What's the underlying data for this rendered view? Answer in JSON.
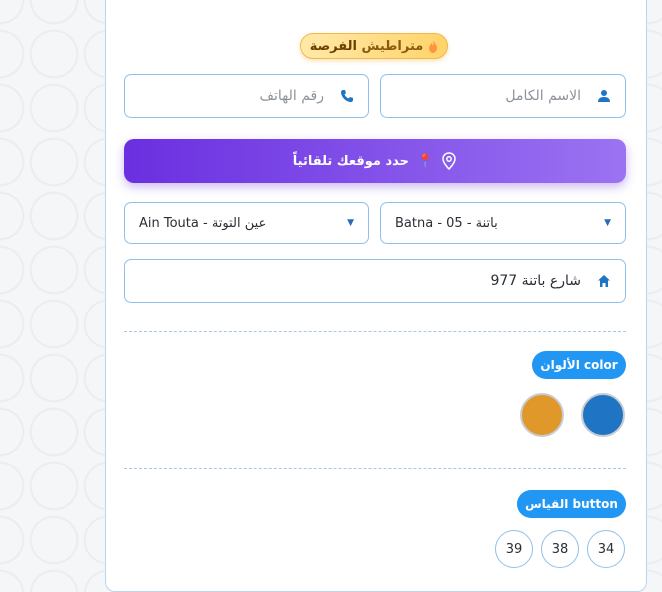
{
  "badge": {
    "emoji": "🔥",
    "prefix": "متراطيش",
    "highlight": "الفرصة"
  },
  "form": {
    "name_placeholder": "الاسم الكامل",
    "phone_placeholder": "رقم الهاتف",
    "locate_label": "حدد موقعك تلقائياً",
    "locate_pin": "📍",
    "wilaya_value": "Batna - 05 - باتنة",
    "commune_value": "Ain Touta - عين التوتة",
    "address_value": "شارع باتنة 977"
  },
  "colors_section": {
    "label": "الألوان color",
    "swatches": [
      {
        "name": "blue",
        "hex": "#1f74c4"
      },
      {
        "name": "orange",
        "hex": "#e0982b"
      }
    ]
  },
  "size_section": {
    "label": "القياس button",
    "options": [
      "34",
      "38",
      "39"
    ]
  },
  "icons": {
    "user": "user-icon",
    "phone": "phone-icon",
    "location": "location-pin-icon",
    "home": "home-icon",
    "caret": "caret-down-icon"
  },
  "accent": "#2196f3"
}
